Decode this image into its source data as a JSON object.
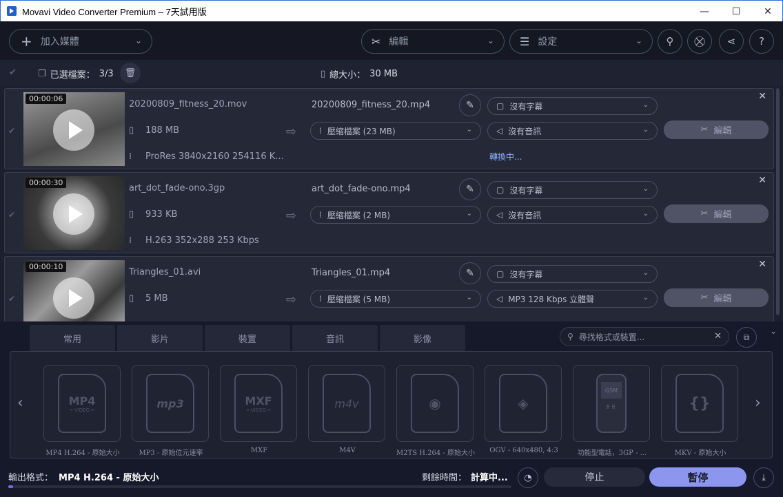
{
  "window": {
    "title": "Movavi Video Converter Premium – 7天試用版",
    "minimize": "—",
    "maximize": "☐",
    "close": "✕"
  },
  "toolbar": {
    "add_media": "加入媒體",
    "edit": "編輯",
    "settings": "設定",
    "icons": [
      "search-icon",
      "cart-icon",
      "share-icon",
      "help-icon"
    ]
  },
  "selection": {
    "selected_label": "已選檔案：",
    "selected_count": "3/3",
    "total_size_label": "總大小：",
    "total_size": "30 MB"
  },
  "files": [
    {
      "duration": "00:00:06",
      "name": "20200809_fitness_20.mov",
      "size": "188 MB",
      "codec": "ProRes 3840x2160 254116 K...",
      "output_name": "20200809_fitness_20.mp4",
      "compress": "壓縮檔案 (23 MB)",
      "subtitle": "沒有字幕",
      "audio": "沒有音訊",
      "edit": "編輯",
      "status": "轉換中..."
    },
    {
      "duration": "00:00:30",
      "name": "art_dot_fade-ono.3gp",
      "size": "933 KB",
      "codec": "H.263 352x288 253 Kbps",
      "output_name": "art_dot_fade-ono.mp4",
      "compress": "壓縮檔案 (2 MB)",
      "subtitle": "沒有字幕",
      "audio": "沒有音訊",
      "edit": "編輯"
    },
    {
      "duration": "00:00:10",
      "name": "Triangles_01.avi",
      "size": "5 MB",
      "codec": "",
      "output_name": "Triangles_01.mp4",
      "compress": "壓縮檔案 (5 MB)",
      "subtitle": "沒有字幕",
      "audio": "MP3 128 Kbps 立體聲",
      "edit": "編輯"
    }
  ],
  "format_panel": {
    "tabs": [
      "常用",
      "影片",
      "裝置",
      "音訊",
      "影像"
    ],
    "search_placeholder": "尋找格式或裝置...",
    "presets": [
      {
        "label": "MP4 H.264 - 原始大小",
        "logo": "MP4"
      },
      {
        "label": "MP3 - 原始位元速率",
        "logo": "mp3"
      },
      {
        "label": "MXF",
        "logo": "MXF"
      },
      {
        "label": "M4V",
        "logo": "m4v"
      },
      {
        "label": "M2TS H.264 - 原始大小",
        "logo": ""
      },
      {
        "label": "OGV - 640x480, 4:3",
        "logo": ""
      },
      {
        "label": "功能型電話，3GP - ...",
        "logo": "GSM"
      },
      {
        "label": "MKV - 原始大小",
        "logo": "{}"
      }
    ]
  },
  "bottom": {
    "output_format_label": "輸出格式：",
    "output_format": "MP4 H.264 - 原始大小",
    "remaining_label": "剩餘時間：",
    "remaining_value": "計算中...",
    "stop": "停止",
    "pause": "暫停",
    "progress": 0.01
  }
}
